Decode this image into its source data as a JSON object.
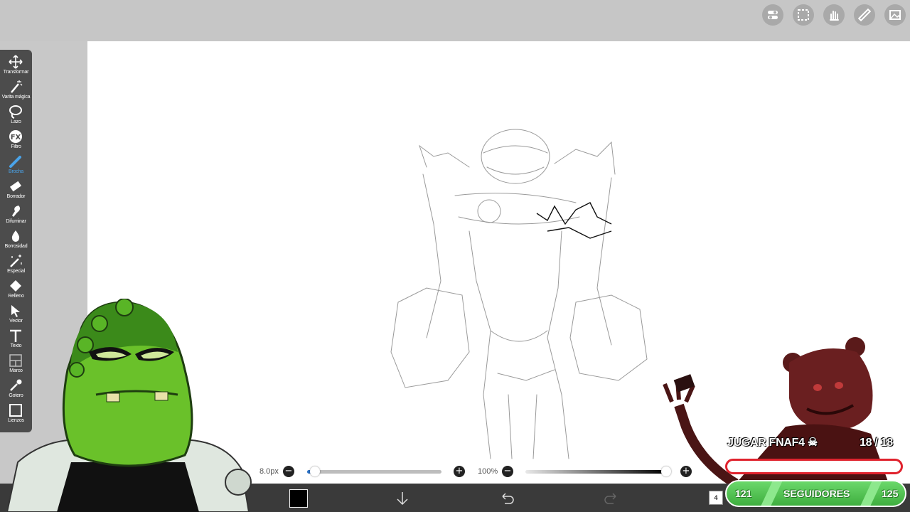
{
  "toolbar": {
    "tools": [
      {
        "label": "Transformar",
        "icon": "move-icon"
      },
      {
        "label": "Varita mágica",
        "icon": "magic-wand-icon"
      },
      {
        "label": "Lazo",
        "icon": "lasso-icon"
      },
      {
        "label": "Filtro",
        "icon": "fx-filter-icon"
      },
      {
        "label": "Brocha",
        "icon": "brush-icon",
        "active": true
      },
      {
        "label": "Borrador",
        "icon": "eraser-icon"
      },
      {
        "label": "Difuminar",
        "icon": "smudge-icon"
      },
      {
        "label": "Borrosidad",
        "icon": "blur-drop-icon"
      },
      {
        "label": "Especial",
        "icon": "special-wand-icon"
      },
      {
        "label": "Relleno",
        "icon": "fill-bucket-icon"
      },
      {
        "label": "Vector",
        "icon": "vector-cursor-icon"
      },
      {
        "label": "Texto",
        "icon": "text-icon"
      },
      {
        "label": "Marco",
        "icon": "frame-icon"
      },
      {
        "label": "Gotero",
        "icon": "eyedropper-icon"
      },
      {
        "label": "Lienzos",
        "icon": "canvas-icon"
      }
    ]
  },
  "top_icons": [
    "toggle-icon",
    "selection-icon",
    "hand-icon",
    "ruler-icon",
    "gallery-icon"
  ],
  "brush": {
    "size_label": "8.0px",
    "size_fraction": 0.03,
    "opacity_label": "100%",
    "opacity_fraction": 1.0
  },
  "bottom_bar": {
    "color": "#000000",
    "layer_count": "4"
  },
  "overlay": {
    "goal_text": "JUGAR FNAF4 ☠",
    "goal_count": "18 / 18",
    "followers_left": "121",
    "followers_label": "SEGUIDORES",
    "followers_right": "125"
  },
  "colors": {
    "accent": "#4aa3e8",
    "toolbar_bg": "#4c4c4c",
    "followers_green": "#4fc24f",
    "goal_red": "#e0222d"
  }
}
